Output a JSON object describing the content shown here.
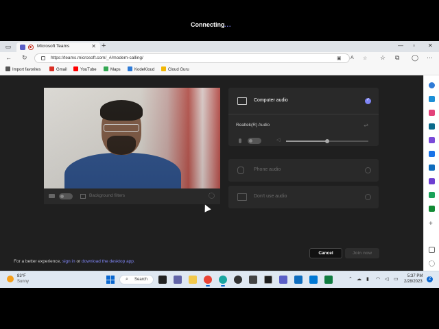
{
  "browser": {
    "tab_title": "Microsoft Teams",
    "url": "https://teams.microsoft.com/_#/modern-calling/",
    "favorites": [
      {
        "label": "Import favorites",
        "color": "#555555"
      },
      {
        "label": "Gmail",
        "color": "#d93025"
      },
      {
        "label": "YouTube",
        "color": "#ff0000"
      },
      {
        "label": "Maps",
        "color": "#34a853"
      },
      {
        "label": "KodeKloud",
        "color": "#2f7bd6"
      },
      {
        "label": "Cloud Guru",
        "color": "#f2b705"
      }
    ]
  },
  "call": {
    "status": "Connecting",
    "status_dots": "...",
    "video_controls": {
      "background_filters_label": "Background filters"
    },
    "audio": {
      "computer_audio_label": "Computer audio",
      "device_name": "Realtek(R) Audio",
      "volume_level": 0.5,
      "phone_audio_label": "Phone audio",
      "no_audio_label": "Don't use audio"
    },
    "buttons": {
      "cancel": "Cancel",
      "join": "Join now"
    },
    "footer": {
      "prefix": "For a better experience,",
      "link1": "sign in",
      "middle": "or",
      "link2": "download the desktop app.",
      "suffix": ""
    }
  },
  "taskbar": {
    "weather_temp": "83°F",
    "weather_desc": "Sunny",
    "search_label": "Search",
    "time": "5:37 PM",
    "date": "2/28/2023",
    "notification_count": "2"
  },
  "colors": {
    "accent": "#7f85f5",
    "page_bg": "#1f1f1f",
    "card_bg": "#292929"
  }
}
